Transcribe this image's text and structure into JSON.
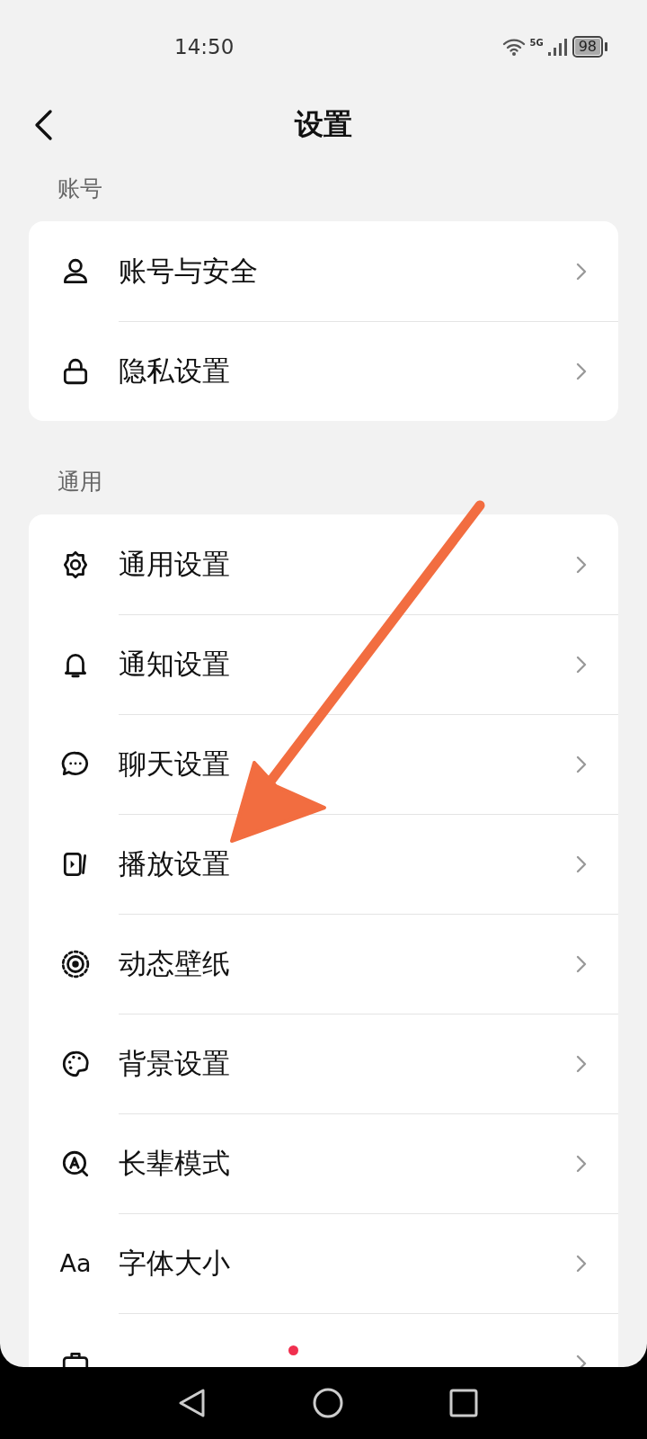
{
  "status_bar": {
    "time": "14:50",
    "network": "5G",
    "battery": "98"
  },
  "header": {
    "title": "设置"
  },
  "sections": [
    {
      "title": "账号",
      "items": [
        {
          "label": "账号与安全",
          "unread": false
        },
        {
          "label": "隐私设置",
          "unread": false
        }
      ]
    },
    {
      "title": "通用",
      "items": [
        {
          "label": "通用设置",
          "unread": false
        },
        {
          "label": "通知设置",
          "unread": false
        },
        {
          "label": "聊天设置",
          "unread": false
        },
        {
          "label": "播放设置",
          "unread": false
        },
        {
          "label": "动态壁纸",
          "unread": false
        },
        {
          "label": "背景设置",
          "unread": false
        },
        {
          "label": "长辈模式",
          "unread": false
        },
        {
          "label": "字体大小",
          "icon_text": "Aa",
          "unread": false
        },
        {
          "unread": true
        }
      ]
    }
  ]
}
